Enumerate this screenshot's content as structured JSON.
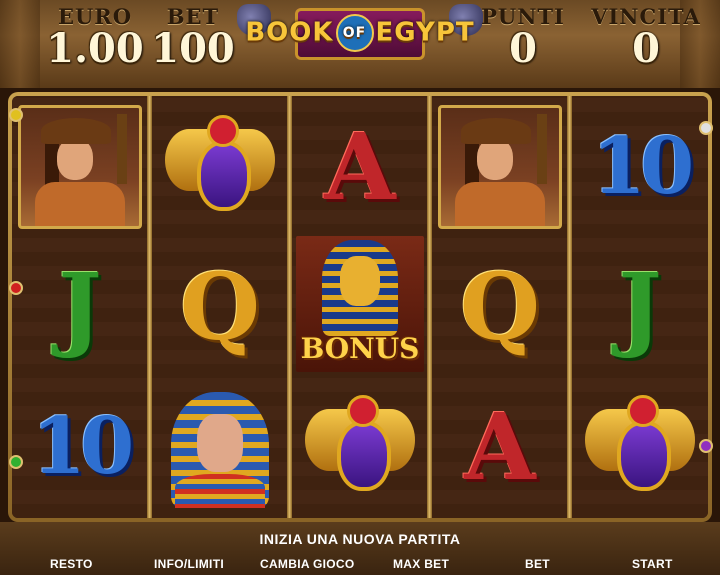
{
  "header": {
    "euro_label": "EURO",
    "euro_value": "1.00",
    "bet_label": "BET",
    "bet_value": "100",
    "logo_text_left": "BOOK",
    "logo_text_of": "OF",
    "logo_text_right": "EGYPT",
    "punti_label": "PUNTI",
    "punti_value": "0",
    "vincita_label": "VINCITA",
    "vincita_value": "0"
  },
  "reels": [
    [
      "explorer",
      "J",
      "10"
    ],
    [
      "scarab",
      "Q",
      "pharaoh"
    ],
    [
      "A",
      "bonus",
      "scarab"
    ],
    [
      "explorer",
      "Q",
      "A"
    ],
    [
      "10",
      "J",
      "scarab"
    ]
  ],
  "bonus_label": "BONUS",
  "status_message": "INIZIA UNA NUOVA PARTITA",
  "buttons": {
    "resto": "RESTO",
    "info": "INFO/LIMITI",
    "cambia": "CAMBIA GIOCO",
    "maxbet": "MAX BET",
    "bet": "BET",
    "start": "START"
  },
  "colors": {
    "frame_gold": "#c9a24e",
    "letter_A": "#c0262a",
    "letter_J": "#2f9a2a",
    "letter_Q": "#e0a020",
    "number_10": "#2e6fd0",
    "bonus_text": "#ffd24a"
  }
}
